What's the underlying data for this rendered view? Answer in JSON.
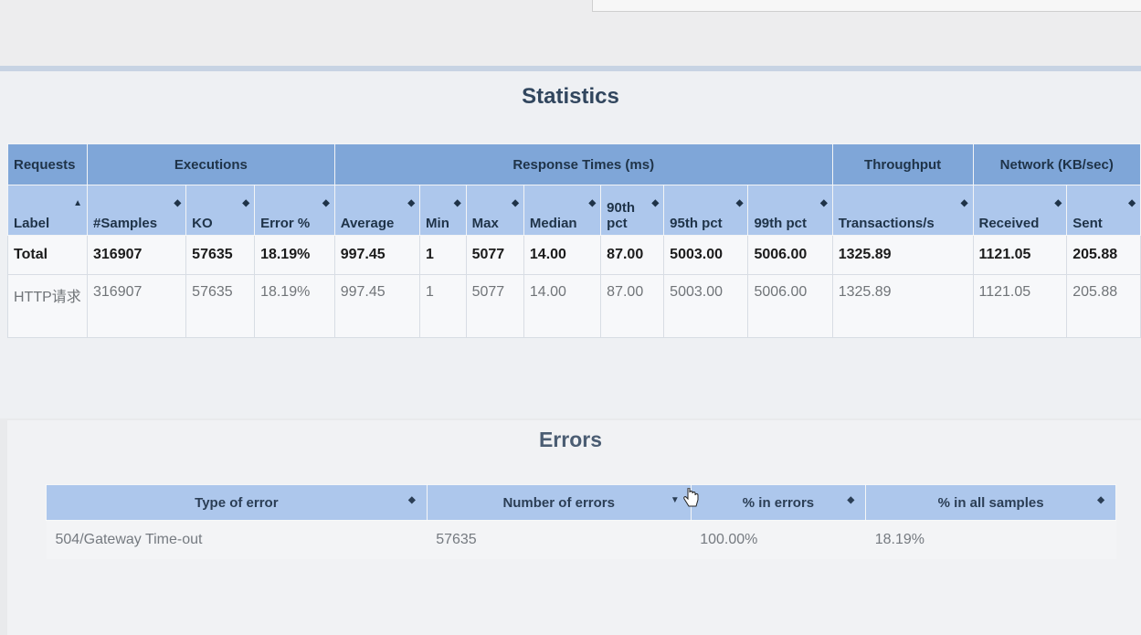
{
  "statistics": {
    "title": "Statistics",
    "group_headers": {
      "requests": "Requests",
      "executions": "Executions",
      "response_times": "Response Times (ms)",
      "throughput": "Throughput",
      "network": "Network (KB/sec)"
    },
    "columns": [
      "Label",
      "#Samples",
      "KO",
      "Error %",
      "Average",
      "Min",
      "Max",
      "Median",
      "90th pct",
      "95th pct",
      "99th pct",
      "Transactions/s",
      "Received",
      "Sent"
    ],
    "total_row": [
      "Total",
      "316907",
      "57635",
      "18.19%",
      "997.45",
      "1",
      "5077",
      "14.00",
      "87.00",
      "5003.00",
      "5006.00",
      "1325.89",
      "1121.05",
      "205.88"
    ],
    "rows": [
      [
        "HTTP请求",
        "316907",
        "57635",
        "18.19%",
        "997.45",
        "1",
        "5077",
        "14.00",
        "87.00",
        "5003.00",
        "5006.00",
        "1325.89",
        "1121.05",
        "205.88"
      ]
    ]
  },
  "errors": {
    "title": "Errors",
    "columns": [
      "Type of error",
      "Number of errors",
      "% in errors",
      "% in all samples"
    ],
    "rows": [
      [
        "504/Gateway Time-out",
        "57635",
        "100.00%",
        "18.19%"
      ]
    ]
  },
  "icons": {
    "sort": "sort-icon",
    "sort_desc": "sort-desc-icon",
    "cursor": "hand-cursor-icon"
  }
}
